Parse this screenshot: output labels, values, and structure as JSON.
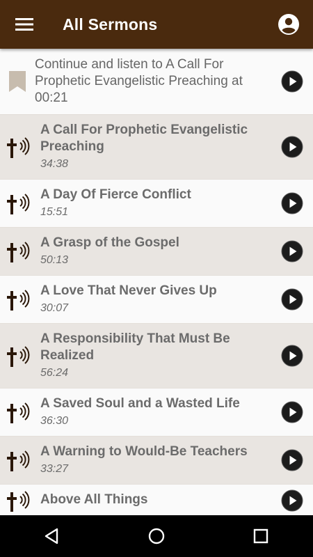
{
  "app_bar": {
    "title": "All Sermons",
    "menu_icon": "hamburger-menu-icon",
    "account_icon": "account-circle-icon",
    "color": "#4a2a0e"
  },
  "continue": {
    "text": "Continue and listen to A Call For Prophetic Evangelistic Preaching at 00:21",
    "icon": "bookmark-icon"
  },
  "sermons": [
    {
      "title": "A Call For Prophetic Evangelistic Preaching",
      "duration": "34:38"
    },
    {
      "title": "A Day Of Fierce Conflict",
      "duration": "15:51"
    },
    {
      "title": "A Grasp of the Gospel",
      "duration": "50:13"
    },
    {
      "title": "A Love That Never Gives Up",
      "duration": "30:07"
    },
    {
      "title": "A Responsibility That Must Be Realized",
      "duration": "56:24"
    },
    {
      "title": "A Saved Soul and a Wasted Life",
      "duration": "36:30"
    },
    {
      "title": "A Warning to Would-Be Teachers",
      "duration": "33:27"
    },
    {
      "title": "Above All Things",
      "duration": ""
    }
  ],
  "nav_bar": {
    "back_icon": "back-triangle-icon",
    "home_icon": "home-circle-icon",
    "recents_icon": "recents-square-icon"
  }
}
